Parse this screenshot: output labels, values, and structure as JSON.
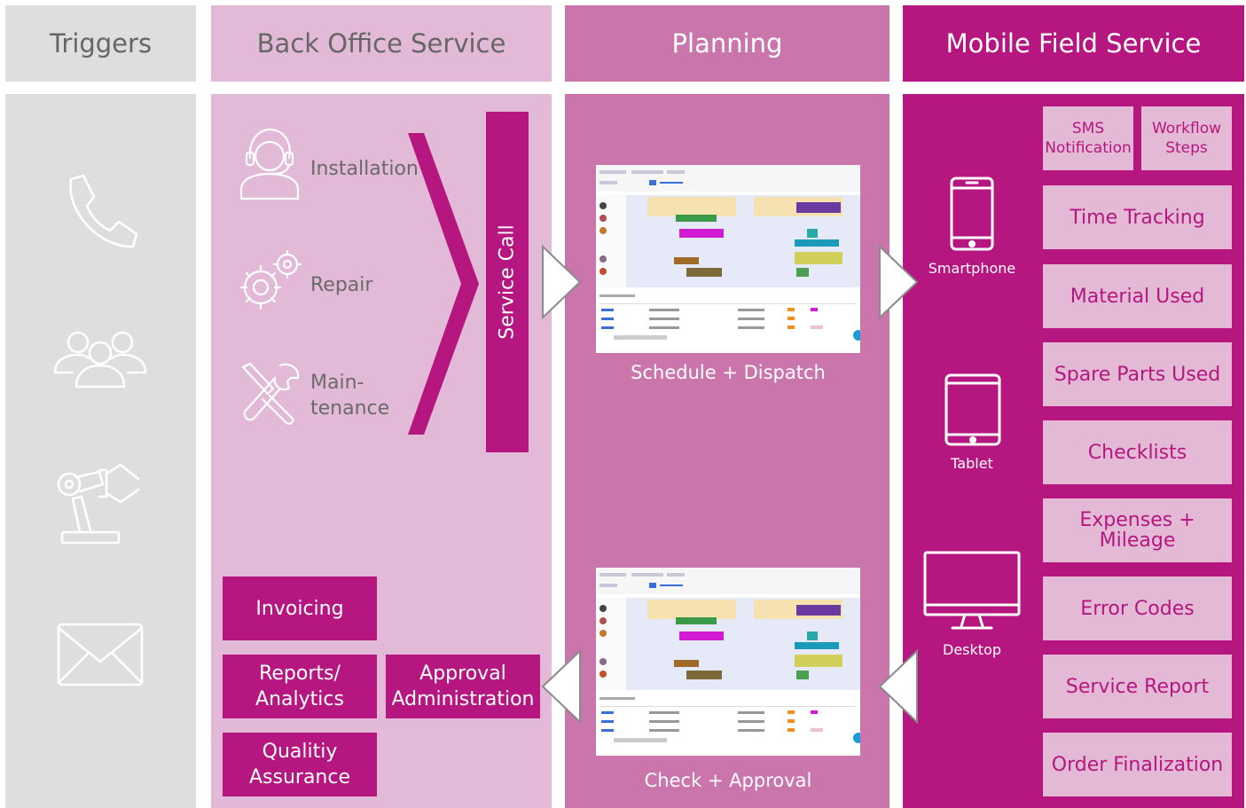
{
  "columns": {
    "triggers": {
      "title": "Triggers",
      "color": "#dedede",
      "header_text_color": "#666666"
    },
    "back_office": {
      "title": "Back Office Service",
      "color": "#e2b9d7",
      "header_text_color": "#666666"
    },
    "planning": {
      "title": "Planning",
      "color": "#cb75ad",
      "header_text_color": "#ffffff"
    },
    "mobile": {
      "title": "Mobile Field Service",
      "color": "#b5167f",
      "header_text_color": "#ffffff"
    }
  },
  "triggers": {
    "icons": [
      "phone-icon",
      "people-icon",
      "robot-arm-icon",
      "envelope-icon"
    ]
  },
  "back_office": {
    "items": [
      {
        "label": "Installation",
        "icon": "headset-person-icon"
      },
      {
        "label": "Repair",
        "icon": "gears-icon"
      },
      {
        "label": "Main-\ntenance",
        "icon": "tools-icon"
      }
    ],
    "service_call": "Service Call",
    "boxes": {
      "invoicing": "Invoicing",
      "reports": "Reports/\nAnalytics",
      "quality": "Qualitiy\nAssurance",
      "approval": "Approval\nAdministration"
    }
  },
  "planning": {
    "schedule_caption": "Schedule + Dispatch",
    "check_caption": "Check + Approval"
  },
  "mobile": {
    "devices": [
      {
        "label": "Smartphone",
        "icon": "smartphone-icon"
      },
      {
        "label": "Tablet",
        "icon": "tablet-icon"
      },
      {
        "label": "Desktop",
        "icon": "desktop-icon"
      }
    ],
    "small_boxes": [
      "SMS\nNotification",
      "Workflow\nSteps"
    ],
    "features": [
      "Time Tracking",
      "Material Used",
      "Spare Parts Used",
      "Checklists",
      "Expenses + Mileage",
      "Error Codes",
      "Service Report",
      "Order Finalization"
    ]
  },
  "colors": {
    "magenta": "#b5167f",
    "light_pink": "#e4b9d6"
  }
}
